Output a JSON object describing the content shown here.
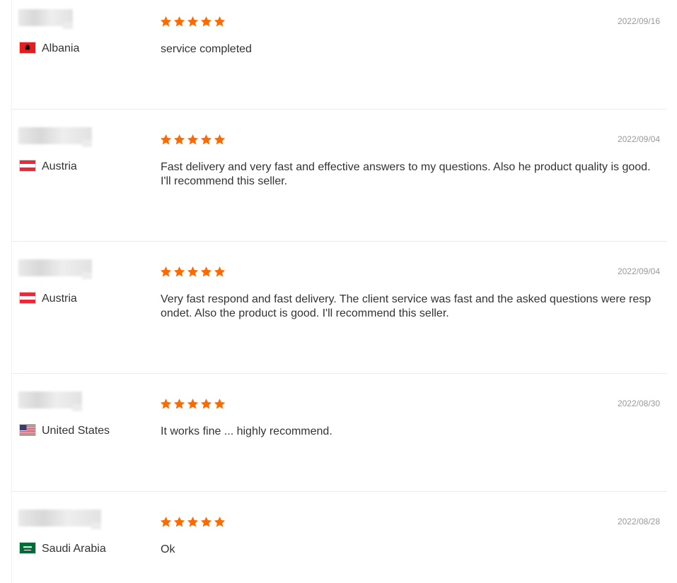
{
  "reviews": [
    {
      "country": "Albania",
      "flag": "albania-flag",
      "rating": 5,
      "date": "2022/09/16",
      "comment": "service completed"
    },
    {
      "country": "Austria",
      "flag": "austria-flag",
      "rating": 5,
      "date": "2022/09/04",
      "comment": "Fast delivery and very fast and effective answers to my questions. Also he product quality is good. I'll recommend this seller."
    },
    {
      "country": "Austria",
      "flag": "austria-flag",
      "rating": 5,
      "date": "2022/09/04",
      "comment": "Very fast respond and fast delivery. The client service was fast and the asked questions were resp ondet. Also the product is good. I'll recommend this seller."
    },
    {
      "country": "United States",
      "flag": "united-states-flag",
      "rating": 5,
      "date": "2022/08/30",
      "comment": "It works fine ... highly recommend."
    },
    {
      "country": "Saudi Arabia",
      "flag": "saudi-arabia-flag",
      "rating": 5,
      "date": "2022/08/28",
      "comment": "Ok"
    }
  ],
  "colors": {
    "star": "#ff6a00",
    "text": "#333333",
    "date": "#999999",
    "divider": "#ebebeb"
  }
}
